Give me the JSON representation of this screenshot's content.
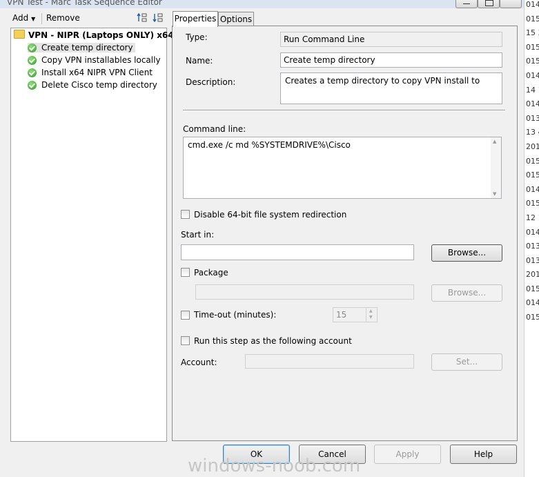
{
  "window": {
    "title": "VPN Test - Marc Task Sequence Editor"
  },
  "right_strip": [
    "014",
    "015",
    "15 3",
    "015",
    "015",
    "014",
    "14 1",
    "014",
    "013",
    "13 4",
    "201",
    "015",
    "015",
    "014",
    "015",
    "12 1",
    "014",
    "013",
    "013",
    "201",
    "015",
    "014",
    "015"
  ],
  "toolbar": {
    "add_label": "Add",
    "remove_label": "Remove",
    "icons": [
      "move-up-icon",
      "move-down-icon"
    ]
  },
  "tree": {
    "root_label": "VPN - NIPR (Laptops ONLY) x64",
    "items": [
      {
        "label": "Create temp directory",
        "selected": true
      },
      {
        "label": "Copy VPN installables locally",
        "selected": false
      },
      {
        "label": "Install x64 NIPR VPN Client",
        "selected": false
      },
      {
        "label": "Delete Cisco temp directory",
        "selected": false
      }
    ]
  },
  "tabs": [
    {
      "label": "Properties",
      "active": true
    },
    {
      "label": "Options",
      "active": false
    }
  ],
  "properties": {
    "type_label": "Type:",
    "type_value": "Run Command Line",
    "name_label": "Name:",
    "name_value": "Create temp directory",
    "description_label": "Description:",
    "description_value": "Creates a temp directory to copy VPN install to",
    "command_line_label": "Command line:",
    "command_line_value": "cmd.exe /c md %SYSTEMDRIVE%\\Cisco",
    "disable_redirection_label": "Disable 64-bit file system redirection",
    "start_in_label": "Start in:",
    "start_in_value": "",
    "browse_label": "Browse...",
    "package_label": "Package",
    "package_value": "",
    "package_browse_label": "Browse...",
    "timeout_label": "Time-out (minutes):",
    "timeout_value": "15",
    "run_as_label": "Run this step as the following account",
    "account_label": "Account:",
    "account_value": "",
    "set_label": "Set..."
  },
  "dialog_buttons": {
    "ok": "OK",
    "cancel": "Cancel",
    "apply": "Apply",
    "help": "Help"
  },
  "watermark": "windows-noob.com"
}
